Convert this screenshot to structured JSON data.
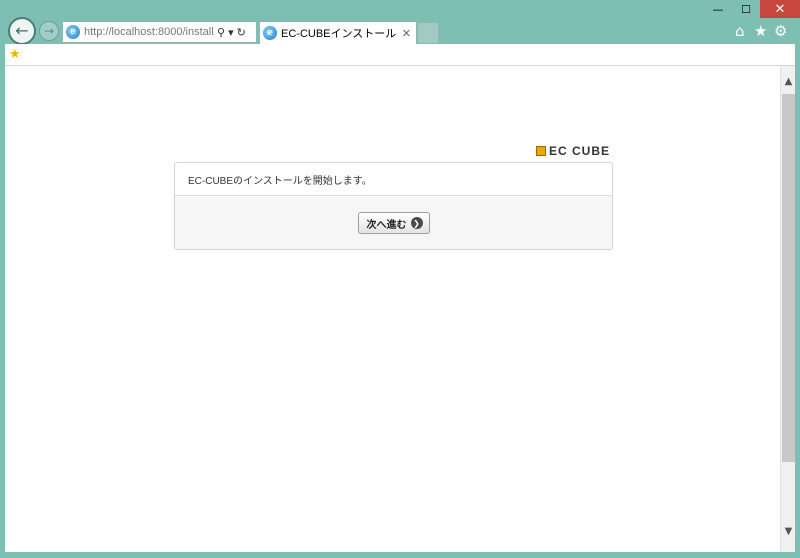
{
  "browser": {
    "url_host": "http://localhost",
    "url_rest": ":8000/install/",
    "tab_title": "EC-CUBEインストール",
    "nav_icons": [
      "back-arrow-icon",
      "forward-arrow-icon"
    ],
    "toolbar_icons": [
      "home-icon",
      "favorites-star-icon",
      "settings-gear-icon"
    ]
  },
  "window": {
    "minimize": "—",
    "maximize": "☐",
    "close": "✕"
  },
  "logo": {
    "text": "EC CUBE"
  },
  "install": {
    "message": "EC-CUBEのインストールを開始します。",
    "next_button": "次へ進む"
  },
  "colors": {
    "frame": "#7ebfb3",
    "close_button": "#c7463d",
    "logo_cube": "#e8a800"
  }
}
